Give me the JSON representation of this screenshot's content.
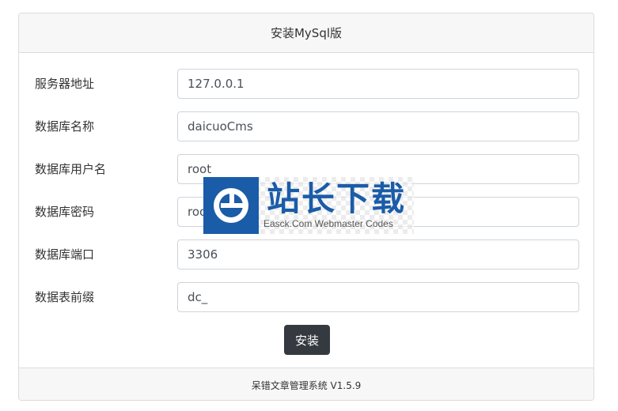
{
  "header": {
    "title": "安装MySql版"
  },
  "form": {
    "fields": [
      {
        "label": "服务器地址",
        "value": "127.0.0.1"
      },
      {
        "label": "数据库名称",
        "value": "daicuoCms"
      },
      {
        "label": "数据库用户名",
        "value": "root"
      },
      {
        "label": "数据库密码",
        "value": "root"
      },
      {
        "label": "数据库端口",
        "value": "3306"
      },
      {
        "label": "数据表前缀",
        "value": "dc_"
      }
    ],
    "submit_label": "安装"
  },
  "footer": {
    "text": "呆错文章管理系统 V1.5.9"
  },
  "watermark": {
    "title": "站长下载",
    "subtitle": "Easck.Com Webmaster Codes",
    "brand_color": "#1a5ca8"
  },
  "colors": {
    "button_bg": "#343a40",
    "header_bg": "#f7f7f7"
  }
}
